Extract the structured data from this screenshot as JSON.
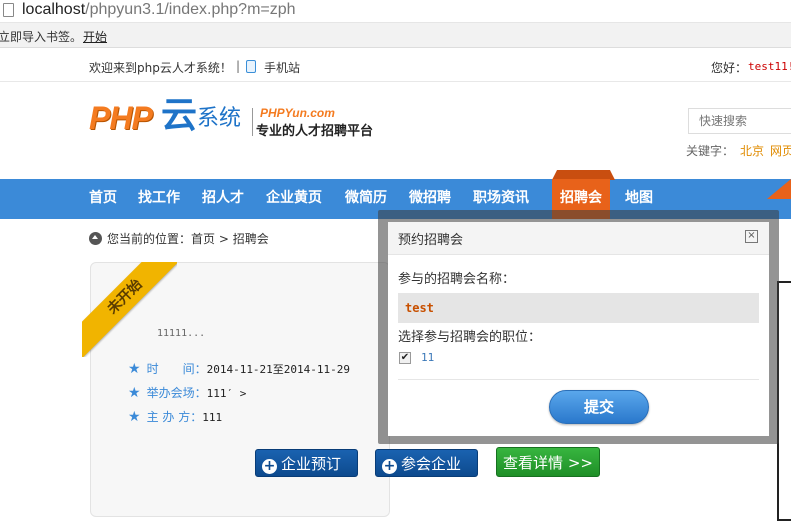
{
  "browser": {
    "url_host": "localhost",
    "url_path": "/phpyun3.1/index.php?m=zph",
    "bookmark_bar_text": "立即导入书签。",
    "bookmark_bar_link": "开始"
  },
  "topbar": {
    "welcome": "欢迎来到php云人才系统！",
    "separator": "|",
    "mobile_site": "手机站",
    "hello": "您好：",
    "username": "test11!"
  },
  "header": {
    "logo_php": "PHP",
    "logo_yun": "云",
    "logo_system": "系统",
    "slogan_en": "PHPYun.com",
    "slogan_cn": "专业的人才招聘平台",
    "search_placeholder": "快速搜索",
    "keywords_label": "关键字：",
    "keywords": [
      "北京",
      "网页"
    ]
  },
  "nav": {
    "items": [
      "首页",
      "找工作",
      "招人才",
      "企业黄页",
      "微简历",
      "微招聘",
      "职场资讯",
      "招聘会",
      "地图"
    ],
    "active_index": 7
  },
  "breadcrumb": {
    "prefix": "您当前的位置：",
    "home": "首页",
    "sep": ">",
    "current": "招聘会"
  },
  "fair_card": {
    "status_ribbon": "未开始",
    "description": "11111...",
    "time_label": "时　　间：",
    "time_value": "2014-11-21至2014-11-29",
    "venue_label": "举办会场：",
    "venue_value": "111′ >",
    "organizer_label": "主 办 方：",
    "organizer_value": "111",
    "buttons": {
      "book": "企业预订",
      "attendees": "参会企业",
      "details": "查看详情 >>"
    }
  },
  "modal": {
    "title": "预约招聘会",
    "close_glyph": "×",
    "fair_name_label": "参与的招聘会名称：",
    "fair_name_value": "test",
    "positions_label": "选择参与招聘会的职位：",
    "positions": [
      {
        "label": "11",
        "checked": true
      }
    ],
    "submit": "提交"
  },
  "colors": {
    "nav_blue": "#3b8ad8",
    "nav_active": "#e8621a",
    "logo_orange": "#f47b20",
    "ribbon_gold": "#f1b400"
  }
}
